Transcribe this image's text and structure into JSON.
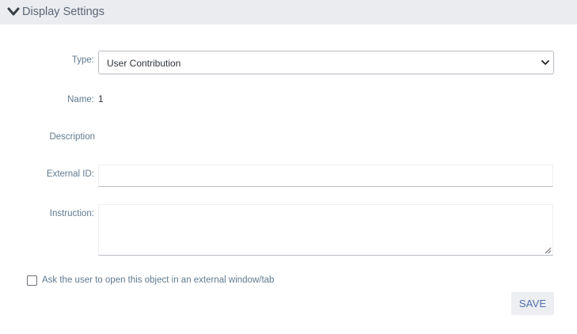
{
  "header": {
    "toggle_icon": "chevron-down-icon",
    "title": "Display Settings"
  },
  "form": {
    "type": {
      "label": "Type:",
      "selected": "User Contribution",
      "icon": "select-arrow-icon"
    },
    "name": {
      "label": "Name:",
      "value": "1"
    },
    "description": {
      "label": "Description"
    },
    "external_id": {
      "label": "External ID:",
      "value": ""
    },
    "instruction": {
      "label": "Instruction:",
      "value": ""
    },
    "external_window": {
      "label": "Ask the user to open this object in an external window/tab",
      "checked": false
    },
    "save_label": "SAVE"
  },
  "colors": {
    "header_bg": "#eaecf0",
    "label_text": "#5f7a91",
    "button_text": "#4f6fb0",
    "button_bg": "#eceef1"
  }
}
